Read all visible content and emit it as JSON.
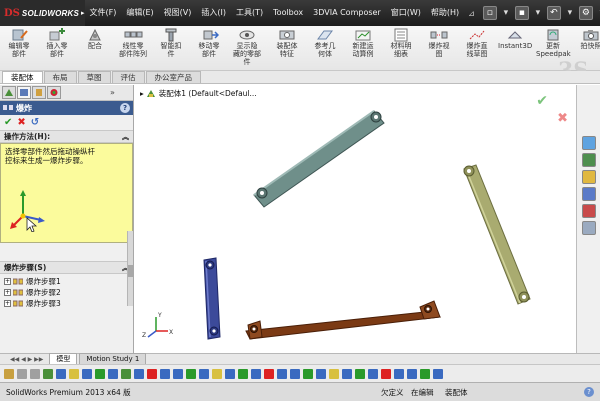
{
  "app": {
    "logo_text": "SOLIDWORKS",
    "logo_mark": "DS"
  },
  "menu": {
    "items": [
      "文件(F)",
      "编辑(E)",
      "视图(V)",
      "插入(I)",
      "工具(T)",
      "Toolbox",
      "3DVIA Composer",
      "窗口(W)",
      "帮助(H)"
    ]
  },
  "ribbon": {
    "buttons": [
      "编辑零\n部件",
      "插入零\n部件",
      "配合",
      "线性零\n部件阵列",
      "智能扣\n件",
      "移动零\n部件",
      "显示隐\n藏的零部件",
      "装配体\n特征",
      "参考几\n何体",
      "新建运\n动算例",
      "材料明\n细表",
      "爆炸视\n图",
      "爆炸直\n线草图",
      "Instant3D",
      "更新\nSpeedpak",
      "拍快照"
    ]
  },
  "command_tabs": [
    "装配体",
    "布局",
    "草图",
    "评估",
    "办公室产品"
  ],
  "property_manager": {
    "title": "爆炸",
    "method_heading": "操作方法(H):",
    "method_text": "选择零部件然后拖动操纵杆\n控标来生成一爆炸步骤。",
    "steps_heading": "爆炸步骤(S)",
    "steps": [
      "爆炸步骤1",
      "爆炸步骤2",
      "爆炸步骤3"
    ]
  },
  "viewport": {
    "tree_label": "装配体1  (Default<Defaul..."
  },
  "bottom_tabs": [
    "模型",
    "Motion Study 1"
  ],
  "status": {
    "product": "SolidWorks Premium 2013 x64 版",
    "under_defined": "欠定义",
    "editing": "在编辑",
    "document": "装配体"
  },
  "colors": {
    "accent": "#3b5b8f",
    "link1": "#6f8f8a",
    "link2": "#a9ab70",
    "link3": "#3c4a9a",
    "link4": "#7b3a14"
  }
}
